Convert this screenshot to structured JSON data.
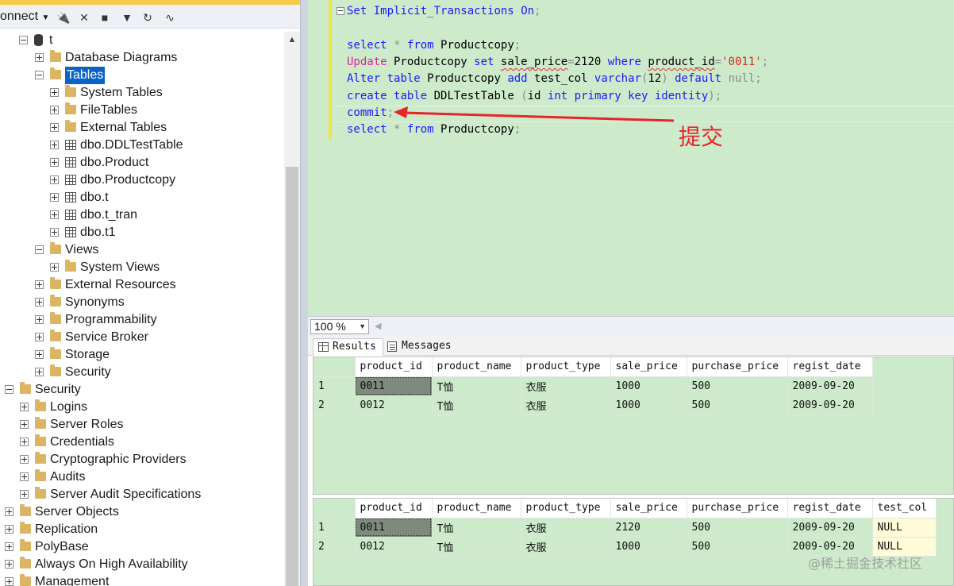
{
  "explorer": {
    "connect_label": "onnect",
    "tree": [
      {
        "label": "t",
        "icon": "database",
        "expander": "minus"
      },
      {
        "label": "Database Diagrams",
        "icon": "folder",
        "expander": "plus"
      },
      {
        "label": "Tables",
        "icon": "folder",
        "expander": "minus",
        "selected": true
      },
      {
        "label": "System Tables",
        "icon": "folder",
        "expander": "plus"
      },
      {
        "label": "FileTables",
        "icon": "folder",
        "expander": "plus"
      },
      {
        "label": "External Tables",
        "icon": "folder",
        "expander": "plus"
      },
      {
        "label": "dbo.DDLTestTable",
        "icon": "table",
        "expander": "plus"
      },
      {
        "label": "dbo.Product",
        "icon": "table",
        "expander": "plus"
      },
      {
        "label": "dbo.Productcopy",
        "icon": "table",
        "expander": "plus"
      },
      {
        "label": "dbo.t",
        "icon": "table",
        "expander": "plus"
      },
      {
        "label": "dbo.t_tran",
        "icon": "table",
        "expander": "plus"
      },
      {
        "label": "dbo.t1",
        "icon": "table",
        "expander": "plus"
      },
      {
        "label": "Views",
        "icon": "folder",
        "expander": "minus"
      },
      {
        "label": "System Views",
        "icon": "folder",
        "expander": "plus"
      },
      {
        "label": "External Resources",
        "icon": "folder",
        "expander": "plus"
      },
      {
        "label": "Synonyms",
        "icon": "folder",
        "expander": "plus"
      },
      {
        "label": "Programmability",
        "icon": "folder",
        "expander": "plus"
      },
      {
        "label": "Service Broker",
        "icon": "folder",
        "expander": "plus"
      },
      {
        "label": "Storage",
        "icon": "folder",
        "expander": "plus"
      },
      {
        "label": "Security",
        "icon": "folder",
        "expander": "plus"
      },
      {
        "label": "Security",
        "icon": "folder",
        "expander": "minus"
      },
      {
        "label": "Logins",
        "icon": "folder",
        "expander": "plus"
      },
      {
        "label": "Server Roles",
        "icon": "folder",
        "expander": "plus"
      },
      {
        "label": "Credentials",
        "icon": "folder",
        "expander": "plus"
      },
      {
        "label": "Cryptographic Providers",
        "icon": "folder",
        "expander": "plus"
      },
      {
        "label": "Audits",
        "icon": "folder",
        "expander": "plus"
      },
      {
        "label": "Server Audit Specifications",
        "icon": "folder",
        "expander": "plus"
      },
      {
        "label": "Server Objects",
        "icon": "folder",
        "expander": "plus"
      },
      {
        "label": "Replication",
        "icon": "folder",
        "expander": "plus"
      },
      {
        "label": "PolyBase",
        "icon": "folder",
        "expander": "plus"
      },
      {
        "label": "Always On High Availability",
        "icon": "folder",
        "expander": "plus"
      },
      {
        "label": "Management",
        "icon": "folder",
        "expander": "plus"
      }
    ]
  },
  "editor": {
    "lines": [
      "Set Implicit_Transactions On;",
      "",
      "select * from Productcopy;",
      "Update Productcopy set sale_price=2120 where product_id='0011';",
      "Alter table Productcopy add test_col varchar(12) default null;",
      "create table DDLTestTable (id int primary key identity);",
      "commit;",
      "select * from Productcopy;"
    ],
    "annotation": "提交"
  },
  "zoom": {
    "value": "100 %"
  },
  "tabs": {
    "results": "Results",
    "messages": "Messages"
  },
  "grid1": {
    "columns": [
      "product_id",
      "product_name",
      "product_type",
      "sale_price",
      "purchase_price",
      "regist_date"
    ],
    "rows": [
      [
        "1",
        "0011",
        "T恤",
        "衣服",
        "1000",
        "500",
        "2009-09-20"
      ],
      [
        "2",
        "0012",
        "T恤",
        "衣服",
        "1000",
        "500",
        "2009-09-20"
      ]
    ]
  },
  "grid2": {
    "columns": [
      "product_id",
      "product_name",
      "product_type",
      "sale_price",
      "purchase_price",
      "regist_date",
      "test_col"
    ],
    "rows": [
      [
        "1",
        "0011",
        "T恤",
        "衣服",
        "2120",
        "500",
        "2009-09-20",
        "NULL"
      ],
      [
        "2",
        "0012",
        "T恤",
        "衣服",
        "1000",
        "500",
        "2009-09-20",
        "NULL"
      ]
    ]
  },
  "watermark": "@稀土掘金技术社区",
  "colors": {
    "editor_bg": "#cdeacb",
    "keyword": "#1a1aff",
    "pink_keyword": "#e0209a",
    "string": "#e0241a",
    "annotation": "#e8242b",
    "selection": "#0a64c8"
  }
}
